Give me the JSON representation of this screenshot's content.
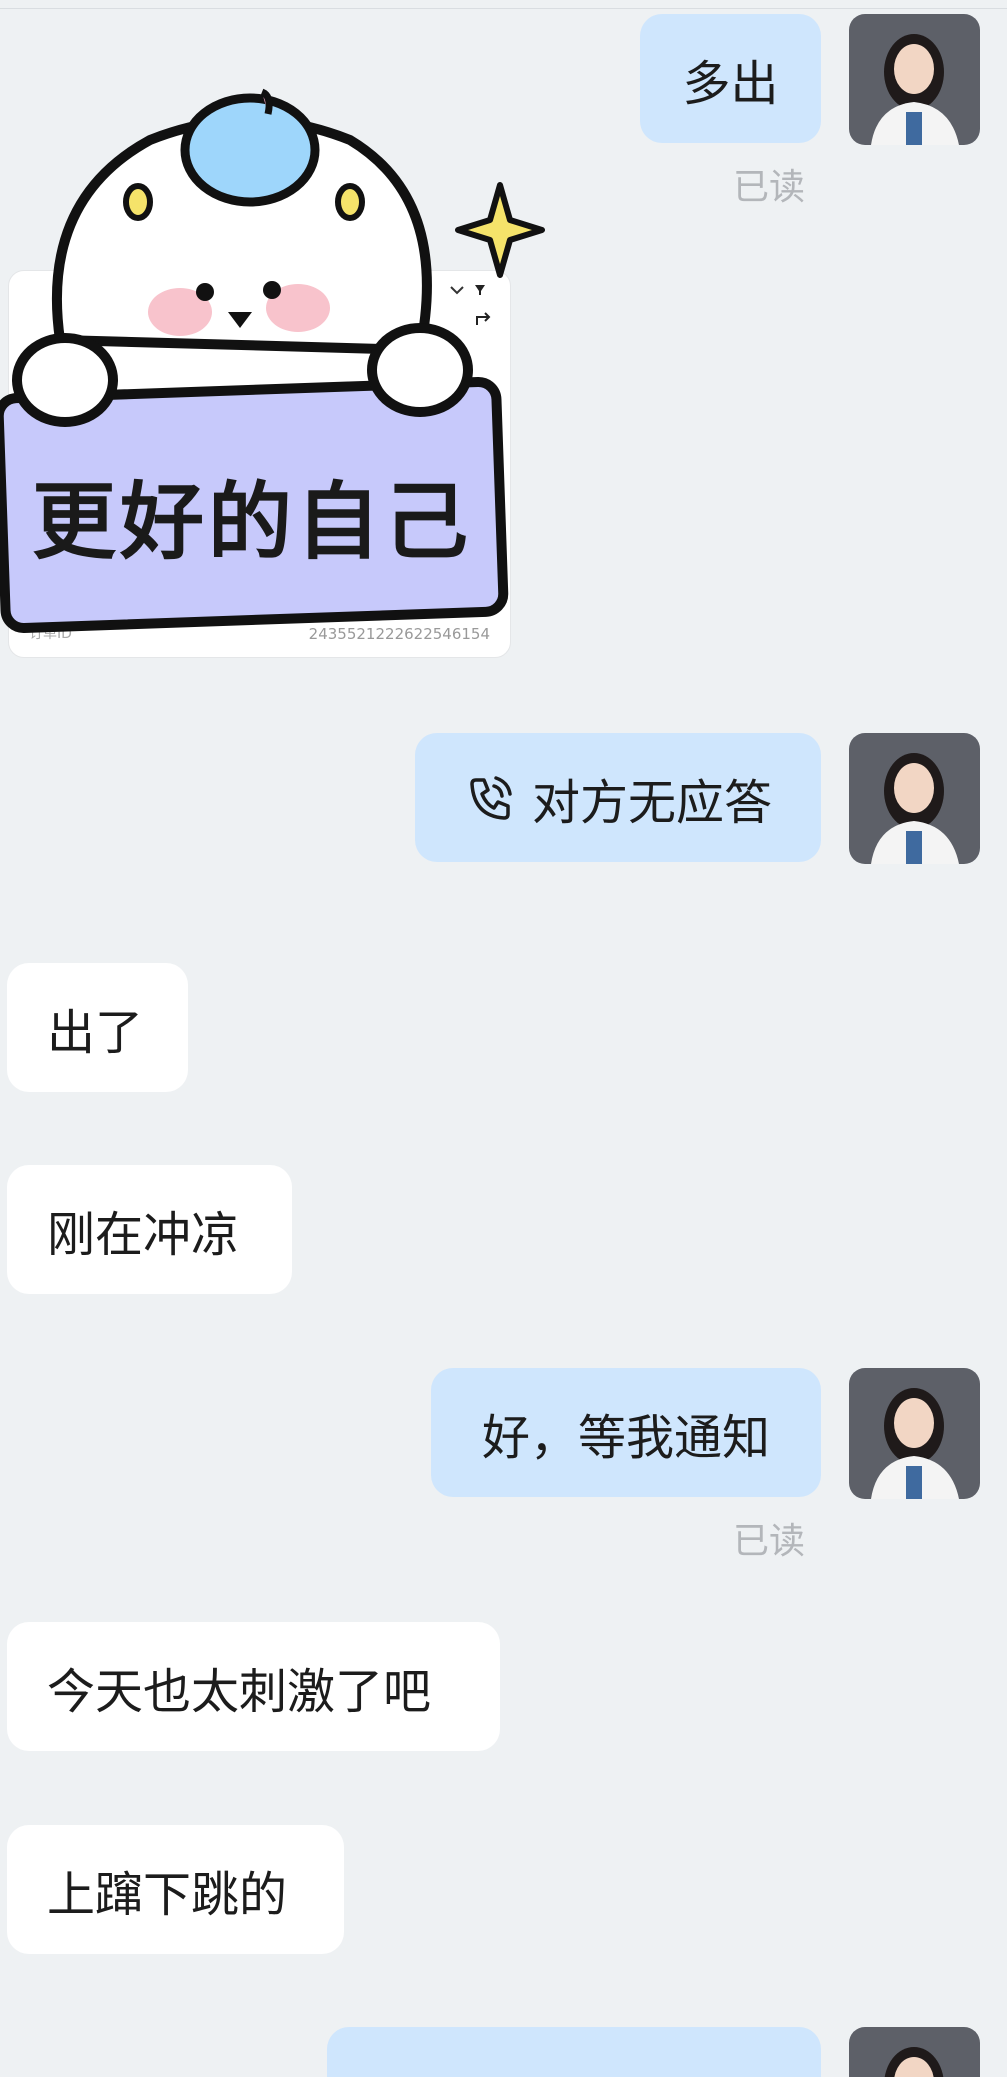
{
  "messages": {
    "m1": {
      "text": "多出",
      "read": "已读"
    },
    "sticker": {
      "caption": "更好的自己"
    },
    "order_card": {
      "id_label": "订单ID",
      "order_number": "2435521222622546154"
    },
    "m2": {
      "text": "对方无应答"
    },
    "m3": {
      "text": "出了"
    },
    "m4": {
      "text": "刚在冲凉"
    },
    "m5": {
      "text": "好，等我通知",
      "read": "已读"
    },
    "m6": {
      "text": "今天也太刺激了吧"
    },
    "m7": {
      "text": "上蹿下跳的"
    }
  },
  "colors": {
    "background": "#eef1f3",
    "outgoing_bubble": "#cfe6fd",
    "incoming_bubble": "#ffffff",
    "read_receipt": "#b3b6ba",
    "sticker_sign": "#c7c9fb",
    "sticker_hat": "#9ed6fb"
  },
  "icons": {
    "call": "phone-missed-call-icon",
    "avatar": "user-avatar-photo"
  }
}
